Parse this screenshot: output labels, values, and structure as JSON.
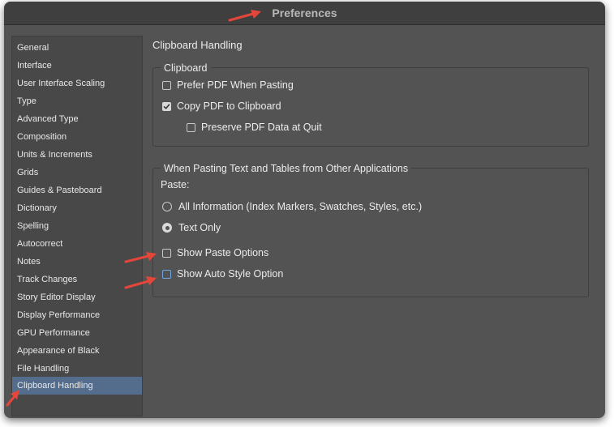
{
  "window": {
    "title": "Preferences"
  },
  "sidebar": {
    "items": [
      {
        "label": "General"
      },
      {
        "label": "Interface"
      },
      {
        "label": "User Interface Scaling"
      },
      {
        "label": "Type"
      },
      {
        "label": "Advanced Type"
      },
      {
        "label": "Composition"
      },
      {
        "label": "Units & Increments"
      },
      {
        "label": "Grids"
      },
      {
        "label": "Guides & Pasteboard"
      },
      {
        "label": "Dictionary"
      },
      {
        "label": "Spelling"
      },
      {
        "label": "Autocorrect"
      },
      {
        "label": "Notes"
      },
      {
        "label": "Track Changes"
      },
      {
        "label": "Story Editor Display"
      },
      {
        "label": "Display Performance"
      },
      {
        "label": "GPU Performance"
      },
      {
        "label": "Appearance of Black"
      },
      {
        "label": "File Handling"
      },
      {
        "label": "Clipboard Handling"
      }
    ],
    "selected": "Clipboard Handling"
  },
  "main": {
    "heading": "Clipboard Handling",
    "clipboard_group": {
      "title": "Clipboard",
      "prefer_pdf": {
        "label": "Prefer PDF When Pasting",
        "checked": false
      },
      "copy_pdf": {
        "label": "Copy PDF to Clipboard",
        "checked": true
      },
      "preserve_pdf": {
        "label": "Preserve PDF Data at Quit",
        "checked": false
      }
    },
    "paste_group": {
      "title": "When Pasting Text and Tables from Other Applications",
      "paste_label": "Paste:",
      "all_information": {
        "label": "All Information (Index Markers, Swatches, Styles, etc.)",
        "selected": false
      },
      "text_only": {
        "label": "Text Only",
        "selected": true
      },
      "show_paste_options": {
        "label": "Show Paste Options",
        "checked": false
      },
      "show_auto_style": {
        "label": "Show Auto Style Option",
        "checked": false
      }
    }
  },
  "annotations": {
    "arrow_color": "#e4473a"
  },
  "colors": {
    "window_bg": "#535353",
    "selected_item": "#546d8c"
  }
}
